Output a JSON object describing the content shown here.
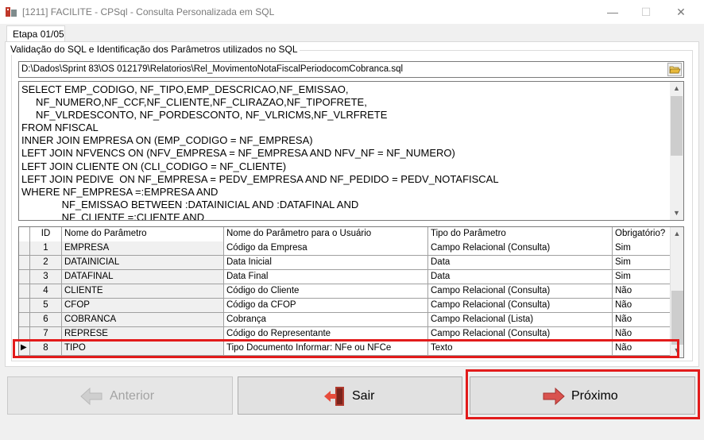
{
  "window": {
    "title": "[1211] FACILITE - CPSql - Consulta Personalizada em SQL",
    "minimize": "—",
    "maximize": "☐",
    "close": "✕"
  },
  "tab": {
    "label": "Etapa 01/05"
  },
  "group": {
    "label": "Validação do SQL e Identificação dos Parâmetros utilizados no SQL"
  },
  "path": {
    "value": "D:\\Dados\\Sprint 83\\OS 012179\\Relatorios\\Rel_MovimentoNotaFiscalPeriodocomCobranca.sql"
  },
  "sql": {
    "text": "SELECT EMP_CODIGO, NF_TIPO,EMP_DESCRICAO,NF_EMISSAO,\n     NF_NUMERO,NF_CCF,NF_CLIENTE,NF_CLIRAZAO,NF_TIPOFRETE,\n     NF_VLRDESCONTO, NF_PORDESCONTO, NF_VLRICMS,NF_VLRFRETE\nFROM NFISCAL\nINNER JOIN EMPRESA ON (EMP_CODIGO = NF_EMPRESA)\nLEFT JOIN NFVENCS ON (NFV_EMPRESA = NF_EMPRESA AND NFV_NF = NF_NUMERO)\nLEFT JOIN CLIENTE ON (CLI_CODIGO = NF_CLIENTE)\nLEFT JOIN PEDIVE  ON NF_EMPRESA = PEDV_EMPRESA AND NF_PEDIDO = PEDV_NOTAFISCAL\nWHERE NF_EMPRESA =:EMPRESA AND\n              NF_EMISSAO BETWEEN :DATAINICIAL AND :DATAFINAL AND\n              NF_CLIENTE =:CLIENTE AND"
  },
  "grid": {
    "columns": [
      "ID",
      "Nome do Parâmetro",
      "Nome do Parâmetro para o Usuário",
      "Tipo do Parâmetro",
      "Obrigatório?"
    ],
    "rows": [
      [
        "1",
        "EMPRESA",
        "Código da Empresa",
        "Campo Relacional (Consulta)",
        "Sim"
      ],
      [
        "2",
        "DATAINICIAL",
        "Data Inicial",
        "Data",
        "Sim"
      ],
      [
        "3",
        "DATAFINAL",
        "Data Final",
        "Data",
        "Sim"
      ],
      [
        "4",
        "CLIENTE",
        "Código do Cliente",
        "Campo Relacional (Consulta)",
        "Não"
      ],
      [
        "5",
        "CFOP",
        "Código da CFOP",
        "Campo Relacional (Consulta)",
        "Não"
      ],
      [
        "6",
        "COBRANCA",
        "Cobrança",
        "Campo Relacional (Lista)",
        "Não"
      ],
      [
        "7",
        "REPRESE",
        "Código do Representante",
        "Campo Relacional (Consulta)",
        "Não"
      ],
      [
        "8",
        "TIPO",
        "Tipo Documento Informar: NFe ou NFCe",
        "Texto",
        "Não"
      ]
    ],
    "current_row_indicator": "▶"
  },
  "buttons": {
    "prev": "Anterior",
    "exit": "Sair",
    "next": "Próximo"
  },
  "colors": {
    "highlight": "#e21b1b",
    "arrow_red": "#d9534f"
  },
  "icons": [
    "app-icon",
    "folder-open-icon",
    "arrow-left-icon",
    "exit-door-icon",
    "arrow-right-icon"
  ]
}
